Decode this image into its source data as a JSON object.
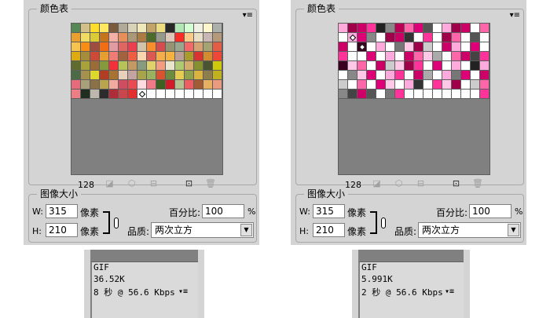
{
  "panels": [
    {
      "color_table": {
        "title": "颜色表",
        "count": "128",
        "colors": [
          "#558855",
          "#d2bf8a",
          "#ffde2b",
          "#ffe75f",
          "#7a5b3e",
          "#b1aa98",
          "#d7d2b8",
          "#efe8b9",
          "#c2a468",
          "#eedd80",
          "#282828",
          "#b2e6b5",
          "#d3ffd2",
          "#f0f0e4",
          "#fff7cc",
          "#acb0aa",
          "#e9a02e",
          "#f2db62",
          "#dbcb37",
          "#c5751b",
          "#f5b0a5",
          "#e88f59",
          "#ab9876",
          "#aa7c41",
          "#4a6b2a",
          "#959a8d",
          "#dcc7b8",
          "#fa2c26",
          "#ffc987",
          "#e8dfc6",
          "#c9b7b5",
          "#b49a7b",
          "#f6c34f",
          "#f78d14",
          "#9e4e40",
          "#f36e13",
          "#e19ba3",
          "#e06661",
          "#eb3f50",
          "#d0c4ab",
          "#f78e2e",
          "#d54c4e",
          "#949472",
          "#9aa68e",
          "#f16a69",
          "#d7a271",
          "#a6a271",
          "#e45e46",
          "#ddaa10",
          "#a48c3a",
          "#cc4a37",
          "#e69e30",
          "#ee7c74",
          "#a16240",
          "#ef5d43",
          "#fad5b0",
          "#da5a53",
          "#f3ad4a",
          "#f4b33e",
          "#bc9f94",
          "#aa9c2c",
          "#d73331",
          "#d48b2f",
          "#ef4737",
          "#5f6c2e",
          "#a8a23b",
          "#9b6b38",
          "#849a3d",
          "#f3313a",
          "#b6c25a",
          "#c49a64",
          "#879c7e",
          "#dfd26d",
          "#f39c82",
          "#e9e4cc",
          "#aecb74",
          "#d4ad6d",
          "#86902f",
          "#4a5430",
          "#cfc90b",
          "#4d6a47",
          "#a5904e",
          "#ddd82b",
          "#b43c23",
          "#a87330",
          "#e8d0bd",
          "#c4a4a1",
          "#a7a44b",
          "#9ab260",
          "#d8532f",
          "#6d8b3e",
          "#e4cb52",
          "#8fa14b",
          "#dab33f",
          "#8c7f4b",
          "#c2b11e",
          "#e66b7b",
          "#a7a07b",
          "#8c7048",
          "#b9a54e",
          "#f0aaa0",
          "#cf4d60",
          "#ea4b53",
          "#ffdadf",
          "#f07a88",
          "#3e6122",
          "#d01b29",
          "#b5c28d",
          "#eb5e61",
          "#a15c36",
          "#e7b060",
          "#ea9a7f",
          "#ec7e84",
          "#1f2e1f",
          "#bdb8ad",
          "#2c2c2c",
          "#af2c39",
          "#c9464b",
          "#e42f2f",
          "#ffffff",
          "#ffffff",
          "#ffffff",
          "#ffffff",
          "#ffffff",
          "#ffffff",
          "#ffffff",
          "#ffffff",
          "#ffffff"
        ]
      },
      "image_size": {
        "title": "图像大小",
        "w_label": "W:",
        "w_value": "315",
        "h_label": "H:",
        "h_value": "210",
        "unit": "像素",
        "percent_label": "百分比:",
        "percent_value": "100",
        "percent_sign": "%",
        "quality_label": "品质:",
        "quality_value": "两次立方"
      },
      "info": {
        "format": "GIF",
        "size": "36.52K",
        "time": "8 秒 @ 56.6 Kbps"
      }
    },
    {
      "color_table": {
        "title": "颜色表",
        "count": "128",
        "colors": [
          "#ffaadd",
          "#a0004a",
          "#cc0066",
          "#ff3399",
          "#222222",
          "#888888",
          "#bb0055",
          "#ff66aa",
          "#dd0077",
          "#555555",
          "#ffffff",
          "#ffaadd",
          "#a0004a",
          "#cc0066",
          "#ffffff",
          "#ff66aa",
          "#ffffff",
          "#ffaadd",
          "#dd0077",
          "#888888",
          "#ffffff",
          "#a0004a",
          "#cc0066",
          "#333333",
          "#ffffff",
          "#ff3399",
          "#ffffff",
          "#a0004a",
          "#ff66aa",
          "#ffffff",
          "#555555",
          "#ffffff",
          "#cc0066",
          "#ffffff",
          "#3a0020",
          "#ffffff",
          "#ffaadd",
          "#ffffff",
          "#777777",
          "#ffc8e6",
          "#a0004a",
          "#cccccc",
          "#ffffff",
          "#cc0066",
          "#ffaadd",
          "#ffffff",
          "#dd0077",
          "#ffffff",
          "#ff3399",
          "#ffffff",
          "#ffffff",
          "#dd0077",
          "#ffffff",
          "#ffaadd",
          "#ffffff",
          "#cc0066",
          "#ff66aa",
          "#ffc8e6",
          "#aaaaaa",
          "#ffffff",
          "#ff66aa",
          "#cc0066",
          "#444444",
          "#ff3399",
          "#3a0020",
          "#ffc8e6",
          "#ff66aa",
          "#ffffff",
          "#cc0066",
          "#cccccc",
          "#ffc8e6",
          "#a0004a",
          "#ff3399",
          "#ffffff",
          "#dd0077",
          "#ffffff",
          "#ffaadd",
          "#ffffff",
          "#222222",
          "#ffaadd",
          "#ffffff",
          "#888888",
          "#ffc8e6",
          "#dd0077",
          "#ffffff",
          "#ffaadd",
          "#ff3399",
          "#ffffff",
          "#cc0066",
          "#aaaaaa",
          "#ffffff",
          "#ffaadd",
          "#777777",
          "#dd0077",
          "#ffffff",
          "#cc0066",
          "#cccccc",
          "#ffffff",
          "#ff66aa",
          "#ffffff",
          "#dd0077",
          "#ffc8e6",
          "#ffffff",
          "#ffaadd",
          "#333333",
          "#ffffff",
          "#ff3399",
          "#ffc8e6",
          "#a0004a",
          "#ffffff",
          "#cccccc",
          "#ff66aa",
          "#888888",
          "#444444",
          "#cc0066",
          "#555555",
          "#ffffff",
          "#777777",
          "#ff3399",
          "#ffffff",
          "#ffffff",
          "#ffffff",
          "#ffffff",
          "#ffffff",
          "#ffffff",
          "#ffffff",
          "#ffffff",
          "#ff3399"
        ]
      },
      "image_size": {
        "title": "图像大小",
        "w_label": "W:",
        "w_value": "315",
        "h_label": "H:",
        "h_value": "210",
        "unit": "像素",
        "percent_label": "百分比:",
        "percent_value": "100",
        "percent_sign": "%",
        "quality_label": "品质:",
        "quality_value": "两次立方"
      },
      "info": {
        "format": "GIF",
        "size": "5.991K",
        "time": "2 秒 @ 56.6 Kbps"
      }
    }
  ],
  "icons": {
    "menu": "panel-menu-icon",
    "dropdown": "chevron-down-icon",
    "link": "chain-link-icon"
  }
}
